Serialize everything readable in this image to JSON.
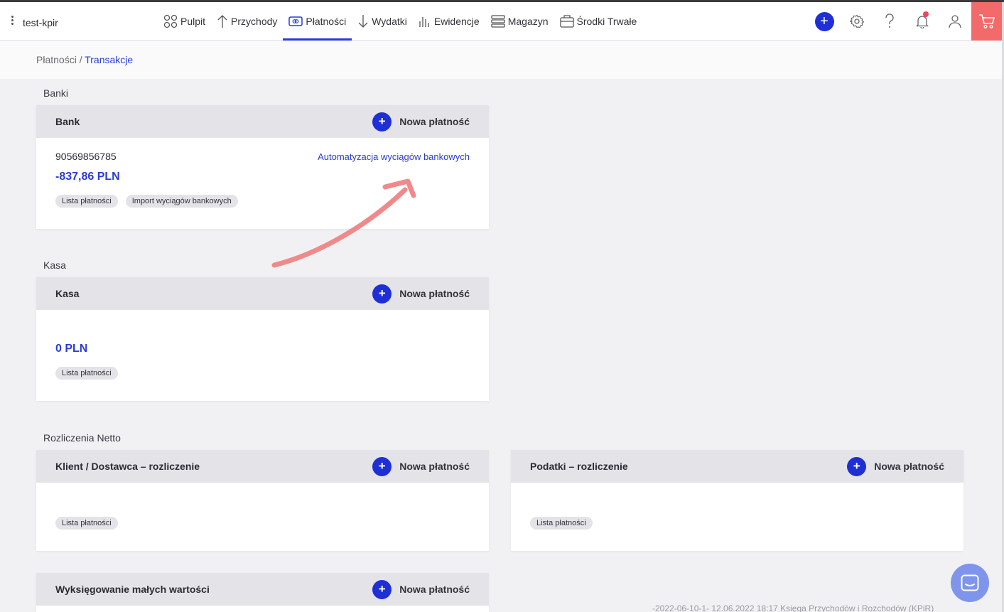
{
  "app": {
    "name": "test-kpir"
  },
  "nav": [
    {
      "key": "pulpit",
      "label": "Pulpit",
      "icon": "dashboard-icon"
    },
    {
      "key": "przychody",
      "label": "Przychody",
      "icon": "arrow-up-icon"
    },
    {
      "key": "platnosci",
      "label": "Płatności",
      "icon": "payment-card-icon",
      "active": true
    },
    {
      "key": "wydatki",
      "label": "Wydatki",
      "icon": "arrow-down-icon"
    },
    {
      "key": "ewidencje",
      "label": "Ewidencje",
      "icon": "bar-chart-icon"
    },
    {
      "key": "magazyn",
      "label": "Magazyn",
      "icon": "warehouse-icon"
    },
    {
      "key": "srodki",
      "label": "Środki Trwałe",
      "icon": "assets-icon"
    }
  ],
  "breadcrumb": {
    "parent": "Płatności",
    "separator": " / ",
    "current": "Transakcje"
  },
  "new_payment_label": "Nowa płatność",
  "sections": {
    "banki": {
      "title": "Banki",
      "card_title": "Bank",
      "account_number": "90569856785",
      "balance": "-837,86 PLN",
      "automation_link": "Automatyzacja wyciągów bankowych",
      "chips": [
        "Lista płatności",
        "Import wyciągów bankowych"
      ]
    },
    "kasa": {
      "title": "Kasa",
      "card_title": "Kasa",
      "balance": "0 PLN",
      "chips": [
        "Lista płatności"
      ]
    },
    "netto": {
      "title": "Rozliczenia Netto",
      "klient_title": "Klient / Dostawca – rozliczenie",
      "klient_chip": "Lista płatności",
      "podatki_title": "Podatki – rozliczenie",
      "podatki_chip": "Lista płatności"
    },
    "wyksiegowanie": {
      "card_title": "Wyksięgowanie małych wartości"
    }
  },
  "footer": "-2022-06-10-1- 12.06.2022 18:17 Księga Przychodów i Rozchodów (KPiR)",
  "colors": {
    "accent": "#2a3bd8",
    "button": "#1f2fd6",
    "cart": "#f26a6a",
    "annotation_arrow": "#f08a8a"
  }
}
